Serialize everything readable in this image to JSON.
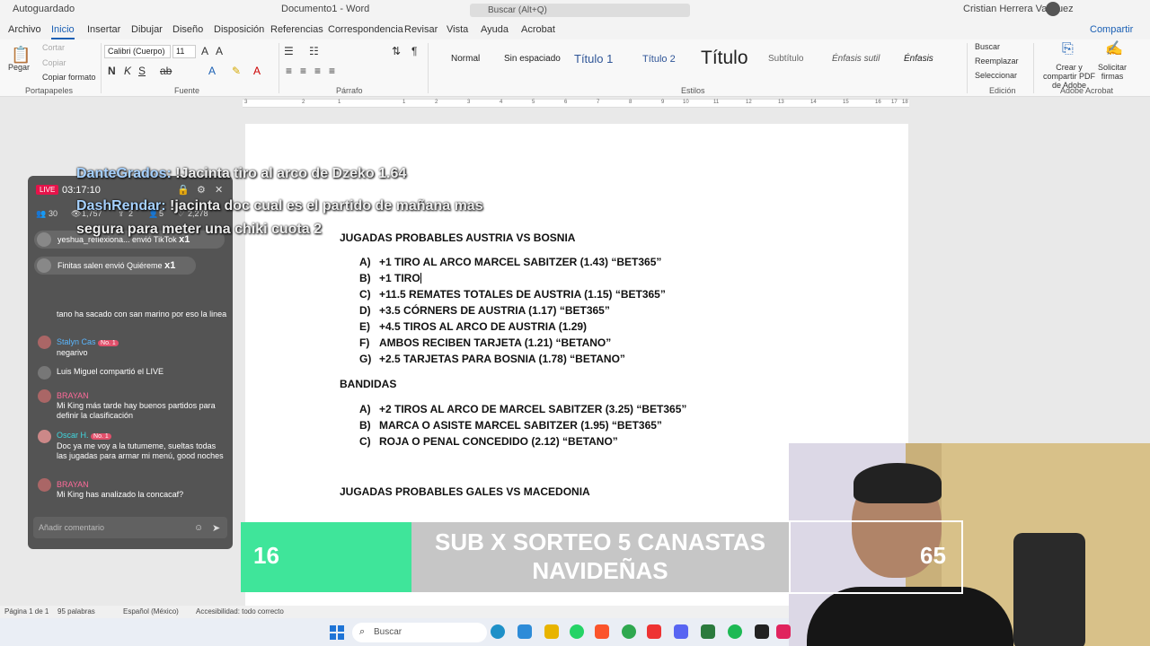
{
  "titlebar": {
    "autosave": "Autoguardado",
    "doc_title": "Documento1 - Word",
    "search": "Buscar (Alt+Q)",
    "user": "Cristian Herrera Vasquez"
  },
  "menu": {
    "tabs": [
      "Archivo",
      "Inicio",
      "Insertar",
      "Dibujar",
      "Diseño",
      "Disposición",
      "Referencias",
      "Correspondencia",
      "Revisar",
      "Vista",
      "Ayuda",
      "Acrobat"
    ],
    "share": "Compartir"
  },
  "ribbon": {
    "paste": "Pegar",
    "cut": "Cortar",
    "copy": "Copiar",
    "format_painter": "Copiar formato",
    "font_name": "Calibri (Cuerpo)",
    "font_size": "11",
    "styles": [
      "Normal",
      "Sin espaciado",
      "Título 1",
      "Título 2",
      "Título",
      "Subtítulo",
      "Énfasis sutil",
      "Énfasis"
    ],
    "find": "Buscar",
    "replace": "Reemplazar",
    "select": "Seleccionar",
    "acrobat_create": "Crear y compartir PDF de Adobe",
    "acrobat_sign": "Solicitar firmas",
    "groups": [
      "Portapapeles",
      "Fuente",
      "Párrafo",
      "Estilos",
      "Edición",
      "Adobe Acrobat"
    ]
  },
  "ruler": [
    "3",
    "2",
    "1",
    "1",
    "2",
    "3",
    "4",
    "5",
    "6",
    "7",
    "8",
    "9",
    "10",
    "11",
    "12",
    "13",
    "14",
    "15",
    "16",
    "17",
    "18"
  ],
  "document": {
    "heading1": "JUGADAS PROBABLES AUSTRIA VS BOSNIA",
    "list1": [
      {
        "key": "A)",
        "text": "+1 TIRO AL ARCO MARCEL SABITZER (1.43) “BET365”"
      },
      {
        "key": "B)",
        "text": "+1 TIRO"
      },
      {
        "key": "C)",
        "text": "+11.5 REMATES TOTALES DE AUSTRIA (1.15) “BET365”"
      },
      {
        "key": "D)",
        "text": "+3.5 CÓRNERS DE AUSTRIA (1.17) “BET365”"
      },
      {
        "key": "E)",
        "text": "+4.5 TIROS AL ARCO DE AUSTRIA (1.29)"
      },
      {
        "key": "F)",
        "text": "AMBOS RECIBEN TARJETA (1.21) “BETANO”"
      },
      {
        "key": "G)",
        "text": "+2.5 TARJETAS PARA BOSNIA (1.78) “BETANO”"
      }
    ],
    "heading2": "BANDIDAS",
    "list2": [
      {
        "key": "A)",
        "text": "+2 TIROS AL ARCO DE MARCEL SABITZER (3.25) “BET365”"
      },
      {
        "key": "B)",
        "text": "MARCA O ASISTE MARCEL SABITZER (1.95) “BET365”"
      },
      {
        "key": "C)",
        "text": "ROJA O PENAL CONCEDIDO (2.12) “BETANO”"
      }
    ],
    "heading3": "JUGADAS PROBABLES GALES VS MACEDONIA"
  },
  "live": {
    "badge": "LIVE",
    "timer": "03:17:10",
    "viewers": "30",
    "views": "1,757",
    "shares": "2",
    "followers": "5",
    "likes": "2,278",
    "gifts": [
      {
        "text": "yeshua_reflexiona... envió TikTok",
        "count": "x1"
      },
      {
        "text": "Finitas salen envió Quiéreme",
        "count": "x1"
      }
    ],
    "messages": [
      {
        "user": "",
        "level": "",
        "text": "tano ha sacado con san marino por eso la linea"
      },
      {
        "user": "Stalyn Cas",
        "level": "No. 1",
        "text": "negarivo"
      },
      {
        "user": "",
        "level": "",
        "text": "Luis Miguel compartió el LIVE"
      },
      {
        "user": "BRAYAN",
        "level": "",
        "text": "Mi King más tarde hay buenos partidos para definir la clasificación"
      },
      {
        "user": "Oscar H.",
        "level": "No. 1",
        "text": "Doc ya me voy a la tutumeme, sueltas todas las jugadas para armar mi menú, good noches"
      },
      {
        "user": "BRAYAN",
        "level": "",
        "text": "Mi King has analizado la concacaf?"
      }
    ],
    "comment_placeholder": "Añadir comentario"
  },
  "overlay_chat": [
    {
      "name": "DanteGrados:",
      "text": "!Jacinta tiro al arco de Dzeko 1.64"
    },
    {
      "name": "DashRendar:",
      "text": "!jacinta doc cual es el partido de mañana mas"
    },
    {
      "name": "",
      "text": "segura para meter una chiki cuota 2"
    }
  ],
  "banner": {
    "count": "16",
    "text_line1": "SUB X SORTEO 5 CANASTAS",
    "text_line2": "NAVIDEÑAS",
    "goal": "65"
  },
  "status": {
    "page": "Página 1 de 1",
    "words": "95 palabras",
    "language": "Español (México)",
    "accessibility": "Accesibilidad: todo correcto"
  },
  "taskbar": {
    "search": "Buscar"
  }
}
